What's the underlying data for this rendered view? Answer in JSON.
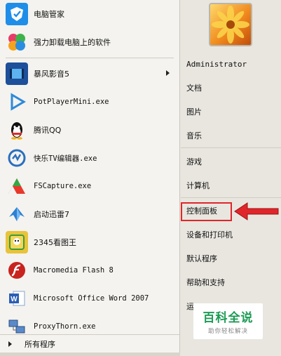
{
  "left": {
    "pinned": [
      {
        "label": "电脑管家",
        "icon": "tencent-pc-manager-icon"
      },
      {
        "label": "强力卸载电脑上的软件",
        "icon": "uninstall-icon"
      }
    ],
    "recent": [
      {
        "label": "暴风影音5",
        "icon": "baofeng-player-icon",
        "has_submenu": true
      },
      {
        "label": "PotPlayerMini.exe",
        "icon": "potplayer-icon",
        "mono": true
      },
      {
        "label": "腾讯QQ",
        "icon": "qq-penguin-icon"
      },
      {
        "label": "快乐TV编辑器.exe",
        "icon": "tv-editor-icon",
        "mono": true
      },
      {
        "label": "FSCapture.exe",
        "icon": "fscapture-icon",
        "mono": true
      },
      {
        "label": "启动迅雷7",
        "icon": "xunlei-icon"
      },
      {
        "label": "2345看图王",
        "icon": "image-viewer-icon"
      },
      {
        "label": "Macromedia Flash 8",
        "icon": "flash-icon",
        "mono": true
      },
      {
        "label": "Microsoft Office Word 2007",
        "icon": "word-icon",
        "mono": true
      },
      {
        "label": "ProxyThorn.exe",
        "icon": "proxythorn-icon",
        "mono": true
      }
    ],
    "all_programs": "所有程序"
  },
  "right": {
    "items": [
      {
        "label": "Administrator"
      },
      {
        "label": "文档"
      },
      {
        "label": "图片"
      },
      {
        "label": "音乐"
      },
      {
        "label": "游戏"
      },
      {
        "label": "计算机"
      },
      {
        "label": "控制面板"
      },
      {
        "label": "设备和打印机"
      },
      {
        "label": "默认程序"
      },
      {
        "label": "帮助和支持"
      },
      {
        "label": "运"
      }
    ]
  },
  "watermark": {
    "title": "百科全说",
    "subtitle": "助你轻松解决"
  },
  "colors": {
    "highlight": "#e0262a",
    "watermark_green": "#1c9b54"
  }
}
